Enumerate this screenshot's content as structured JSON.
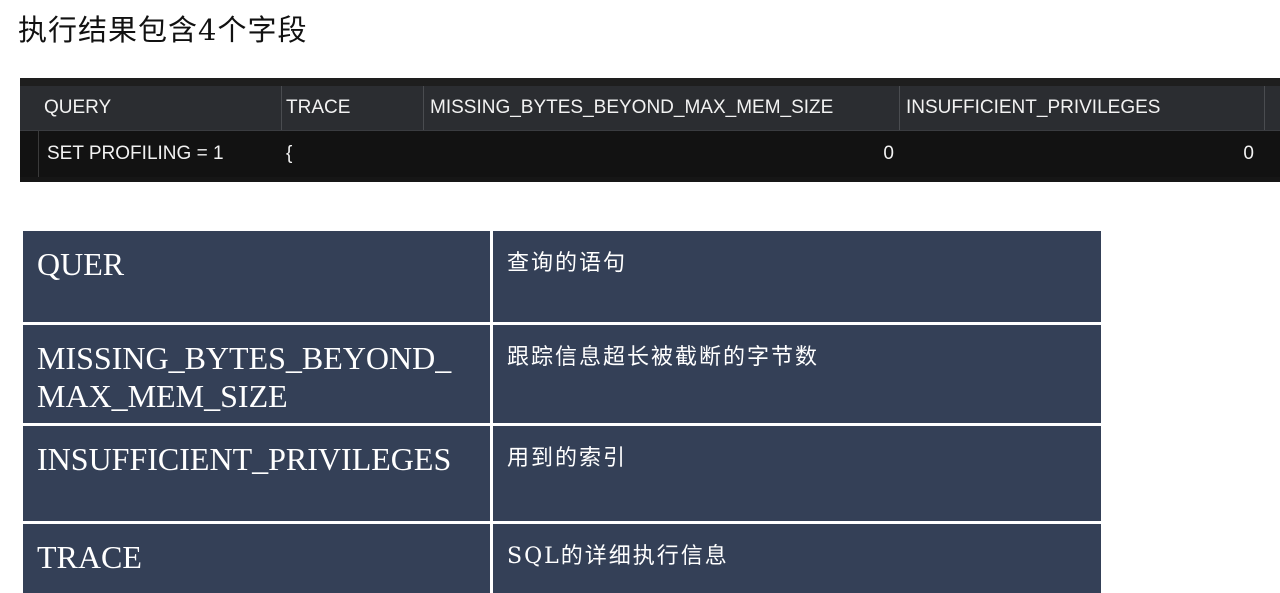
{
  "heading": "执行结果包含4个字段",
  "result_grid": {
    "columns": [
      "QUERY",
      "TRACE",
      "MISSING_BYTES_BEYOND_MAX_MEM_SIZE",
      "INSUFFICIENT_PRIVILEGES"
    ],
    "rows": [
      {
        "query": "SET PROFILING = 1",
        "trace": "{",
        "missing_bytes": "0",
        "insufficient_privileges": "0"
      }
    ]
  },
  "description_table": {
    "rows": [
      {
        "field": "QUER",
        "description": "查询的语句"
      },
      {
        "field": "MISSING_BYTES_BEYOND_MAX_MEM_SIZE",
        "description": "跟踪信息超长被截断的字节数"
      },
      {
        "field": "INSUFFICIENT_PRIVILEGES",
        "description": "用到的索引"
      },
      {
        "field": "TRACE",
        "description": "SQL的详细执行信息"
      }
    ]
  },
  "colors": {
    "grid_background": "#161616",
    "grid_header": "#2b2d31",
    "table_background": "#344057",
    "table_border": "#ffffff"
  }
}
